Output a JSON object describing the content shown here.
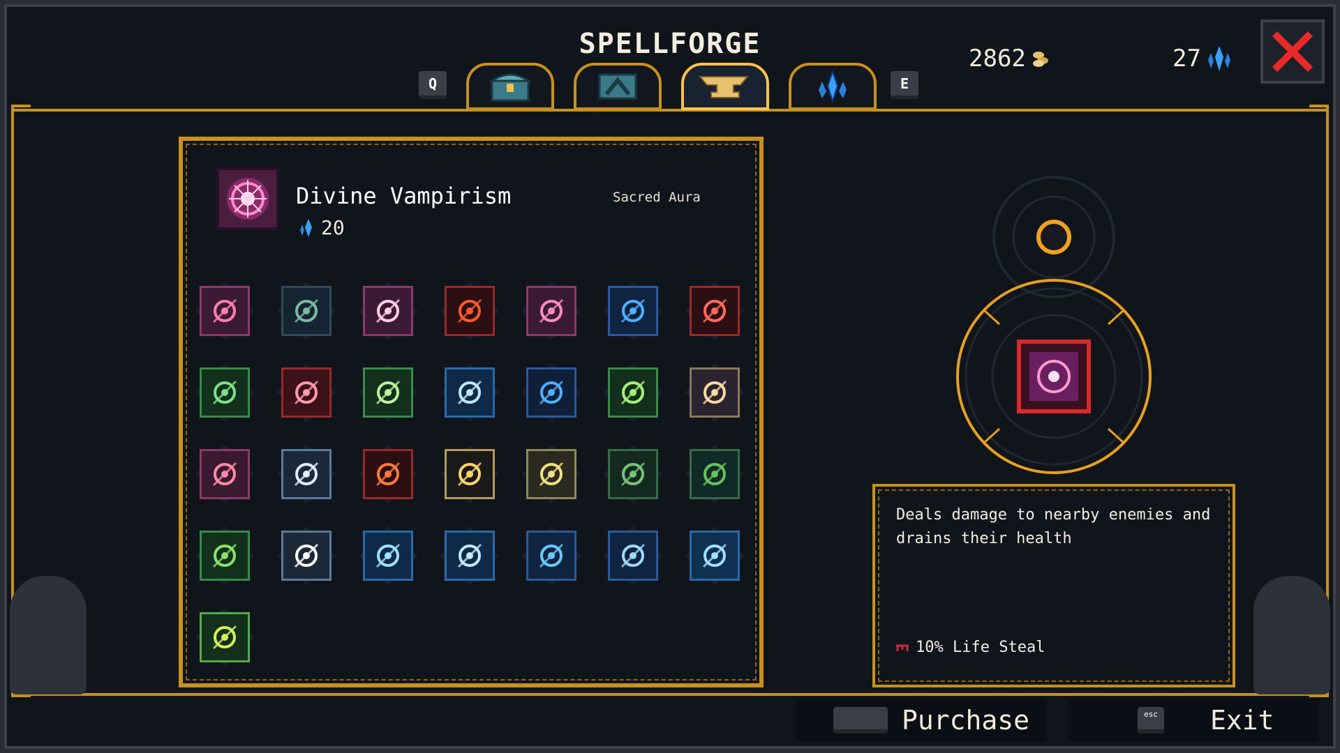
{
  "header": {
    "title": "SPELLFORGE",
    "key_left": "Q",
    "key_right": "E",
    "gold": "2862",
    "crystals": "27",
    "tabs": [
      {
        "icon": "treasure-chest-icon",
        "active": false
      },
      {
        "icon": "crafting-box-icon",
        "active": false
      },
      {
        "icon": "anvil-icon",
        "active": true
      },
      {
        "icon": "crystal-icon",
        "active": false
      }
    ]
  },
  "selected_spell": {
    "name": "Divine Vampirism",
    "cost": "20",
    "category": "Sacred Aura",
    "description": "Deals damage to nearby enemies and drains their health",
    "stat": "10% Life Steal"
  },
  "spell_grid": [
    {
      "icon": "pink-ripple-spell-icon",
      "border": "#8a3a68",
      "bg": "#3b1a35",
      "accent": "#ff7fae"
    },
    {
      "icon": "rune-circle-spell-icon",
      "border": "#2e4a58",
      "bg": "#142431",
      "accent": "#7fb8a0"
    },
    {
      "icon": "sacred-aura-spell-icon",
      "border": "#8a3a68",
      "bg": "#3b1a35",
      "accent": "#ffd0e6"
    },
    {
      "icon": "dark-orb-fire-spell-icon",
      "border": "#9a2a2a",
      "bg": "#2b0f12",
      "accent": "#ff5a2a"
    },
    {
      "icon": "pink-bolt-spell-icon",
      "border": "#8a3a68",
      "bg": "#3b1a35",
      "accent": "#ff8ac0"
    },
    {
      "icon": "blue-vortex-spell-icon",
      "border": "#2a5a9a",
      "bg": "#0f2440",
      "accent": "#4fb0ff"
    },
    {
      "icon": "red-slash-spell-icon",
      "border": "#9a2a2a",
      "bg": "#2b0f12",
      "accent": "#ff6a5a"
    },
    {
      "icon": "expand-arrows-spell-icon",
      "border": "#3a8a4a",
      "bg": "#12301c",
      "accent": "#7fe08a"
    },
    {
      "icon": "red-meteor-spell-icon",
      "border": "#9a2a2a",
      "bg": "#3a1218",
      "accent": "#ff9ab0"
    },
    {
      "icon": "green-target-spell-icon",
      "border": "#3a8a4a",
      "bg": "#12301c",
      "accent": "#c0f0a0"
    },
    {
      "icon": "light-pillar-spell-icon",
      "border": "#2a6aa8",
      "bg": "#0f2a48",
      "accent": "#bfe8ff"
    },
    {
      "icon": "blue-eye-spell-icon",
      "border": "#2a5a9a",
      "bg": "#0f1f38",
      "accent": "#4fb0ff"
    },
    {
      "icon": "green-arrow-spell-icon",
      "border": "#3a8a4a",
      "bg": "#12301c",
      "accent": "#a8f07a"
    },
    {
      "icon": "triple-arrow-spell-icon",
      "border": "#8a7a5a",
      "bg": "#2a2430",
      "accent": "#ffd9a8"
    },
    {
      "icon": "blood-tree-spell-icon",
      "border": "#8a3a68",
      "bg": "#3a1a30",
      "accent": "#ff8aa8"
    },
    {
      "icon": "silver-blade-spell-icon",
      "border": "#5a7a9a",
      "bg": "#1c2838",
      "accent": "#e0ecff"
    },
    {
      "icon": "fire-comet-spell-icon",
      "border": "#9a2a2a",
      "bg": "#2b0f12",
      "accent": "#ff7a3a"
    },
    {
      "icon": "gold-sword-spell-icon",
      "border": "#b89a5a",
      "bg": "#1a1a1a",
      "accent": "#ffd46a"
    },
    {
      "icon": "golden-strike-spell-icon",
      "border": "#8a8a5a",
      "bg": "#2a2a20",
      "accent": "#f0e080"
    },
    {
      "icon": "green-beetle-spell-icon",
      "border": "#3a6a4a",
      "bg": "#142a20",
      "accent": "#7ac07a"
    },
    {
      "icon": "goblin-summon-spell-icon",
      "border": "#3a6a4a",
      "bg": "#102a28",
      "accent": "#6ac05a"
    },
    {
      "icon": "green-leaf-burst-spell-icon",
      "border": "#3a8a4a",
      "bg": "#12301c",
      "accent": "#8ae06a"
    },
    {
      "icon": "white-star-spell-icon",
      "border": "#5a7a9a",
      "bg": "#1c2838",
      "accent": "#ffffff"
    },
    {
      "icon": "ice-lance-spell-icon",
      "border": "#2a6aa8",
      "bg": "#0f2a48",
      "accent": "#9fe0ff"
    },
    {
      "icon": "crossed-ice-spell-icon",
      "border": "#2a6aa8",
      "bg": "#0f2a48",
      "accent": "#bfeaff"
    },
    {
      "icon": "blue-whip-spell-icon",
      "border": "#2a5a9a",
      "bg": "#0f2440",
      "accent": "#6ac8ff"
    },
    {
      "icon": "blue-comet-spell-icon",
      "border": "#2a5a9a",
      "bg": "#0f2440",
      "accent": "#9fd8ff"
    },
    {
      "icon": "tidal-wave-spell-icon",
      "border": "#2a6aa8",
      "bg": "#0f3050",
      "accent": "#9fe0ff"
    },
    {
      "icon": "green-flame-spell-icon",
      "border": "#5aa84a",
      "bg": "#12301c",
      "accent": "#d8f05a"
    }
  ],
  "buttons": {
    "purchase": "Purchase",
    "exit": "Exit",
    "exit_key": "esc"
  }
}
